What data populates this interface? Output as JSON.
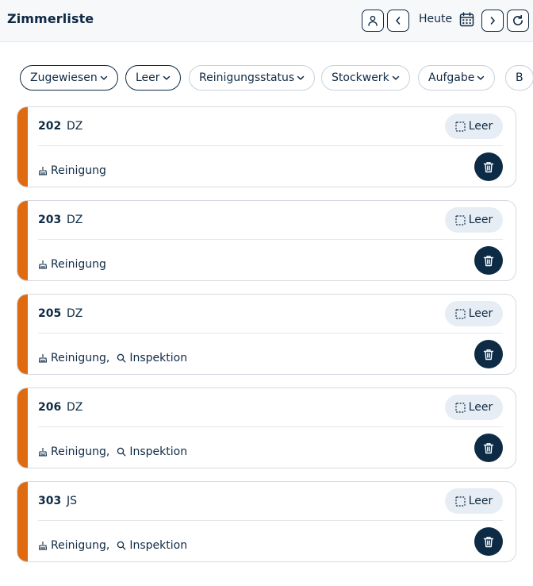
{
  "header": {
    "title": "Zimmerliste",
    "today_label": "Heute"
  },
  "filters": [
    {
      "label": "Zugewiesen",
      "active": true
    },
    {
      "label": "Leer",
      "active": true
    },
    {
      "label": "Reinigungsstatus",
      "active": false
    },
    {
      "label": "Stockwerk",
      "active": false
    },
    {
      "label": "Aufgabe",
      "active": false
    },
    {
      "label": "B",
      "active": false
    }
  ],
  "colors": {
    "accent": "#df6a10",
    "primary": "#0f2a44",
    "status_bg": "#e6edf4"
  },
  "rooms": [
    {
      "number": "202",
      "type": "DZ",
      "status": "Leer",
      "tasks": [
        {
          "icon": "broom-icon",
          "label": "Reinigung"
        }
      ]
    },
    {
      "number": "203",
      "type": "DZ",
      "status": "Leer",
      "tasks": [
        {
          "icon": "broom-icon",
          "label": "Reinigung"
        }
      ]
    },
    {
      "number": "205",
      "type": "DZ",
      "status": "Leer",
      "tasks": [
        {
          "icon": "broom-icon",
          "label": "Reinigung,"
        },
        {
          "icon": "search-icon",
          "label": "Inspektion"
        }
      ]
    },
    {
      "number": "206",
      "type": "DZ",
      "status": "Leer",
      "tasks": [
        {
          "icon": "broom-icon",
          "label": "Reinigung,"
        },
        {
          "icon": "search-icon",
          "label": "Inspektion"
        }
      ]
    },
    {
      "number": "303",
      "type": "JS",
      "status": "Leer",
      "tasks": [
        {
          "icon": "broom-icon",
          "label": "Reinigung,"
        },
        {
          "icon": "search-icon",
          "label": "Inspektion"
        }
      ]
    }
  ]
}
